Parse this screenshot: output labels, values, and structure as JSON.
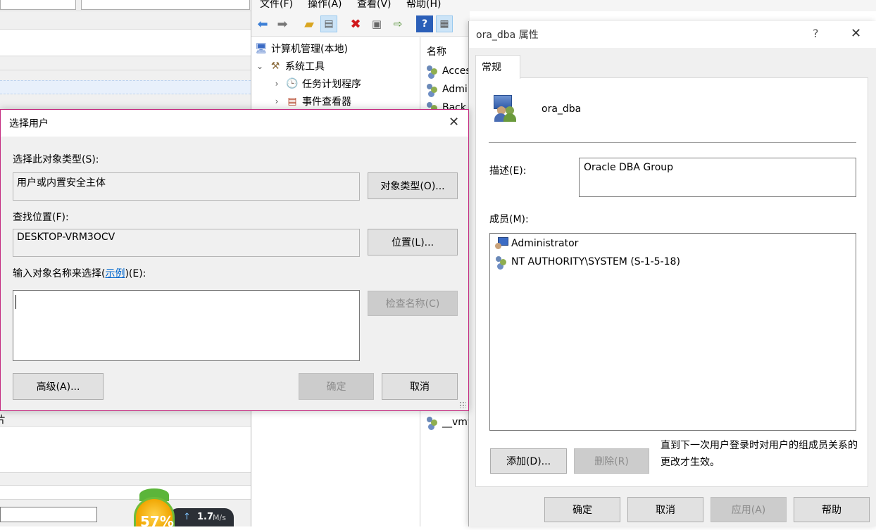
{
  "background_left": {
    "fragment_text": "片"
  },
  "mmc": {
    "menu": [
      "文件(F)",
      "操作(A)",
      "查看(V)",
      "帮助(H)"
    ],
    "toolbar_icons": [
      "back-arrow-icon",
      "forward-arrow-icon",
      "up-folder-icon",
      "show-hide-tree-icon",
      "delete-icon",
      "properties-icon",
      "export-icon",
      "help-icon",
      "action-pane-icon"
    ],
    "tree": {
      "root": "计算机管理(本地)",
      "system_tools": "系统工具",
      "task_scheduler": "任务计划程序",
      "event_viewer": "事件查看器"
    },
    "list_header": "名称",
    "list_items": [
      "Acces",
      "Admi",
      "Back",
      "__vmw"
    ]
  },
  "select_user": {
    "title": "选择用户",
    "object_type_label": "选择此对象类型(S):",
    "object_type_value": "用户或内置安全主体",
    "object_type_button": "对象类型(O)...",
    "location_label": "查找位置(F):",
    "location_value": "DESKTOP-VRM3OCV",
    "location_button": "位置(L)...",
    "enter_names_prefix": "输入对象名称来选择(",
    "enter_names_link": "示例",
    "enter_names_suffix": ")(E):",
    "enter_names_value": "",
    "check_names_button": "检查名称(C)",
    "advanced_button": "高级(A)...",
    "ok_button": "确定",
    "cancel_button": "取消"
  },
  "properties": {
    "title": "ora_dba 属性",
    "help_glyph": "?",
    "tab_general": "常规",
    "group_name": "ora_dba",
    "description_label": "描述(E):",
    "description_value": "Oracle DBA Group",
    "members_label": "成员(M):",
    "members": [
      "Administrator",
      "NT AUTHORITY\\SYSTEM (S-1-5-18)"
    ],
    "add_button": "添加(D)...",
    "remove_button": "删除(R)",
    "note": "直到下一次用户登录时对用户的组成员关系的更改才生效。",
    "ok_button": "确定",
    "cancel_button": "取消",
    "apply_button": "应用(A)",
    "help_button": "帮助"
  },
  "taskbar_widget": {
    "percent": "57%",
    "upload_arrow": "↑",
    "speed_value": "1.7",
    "speed_unit": "M/s"
  }
}
